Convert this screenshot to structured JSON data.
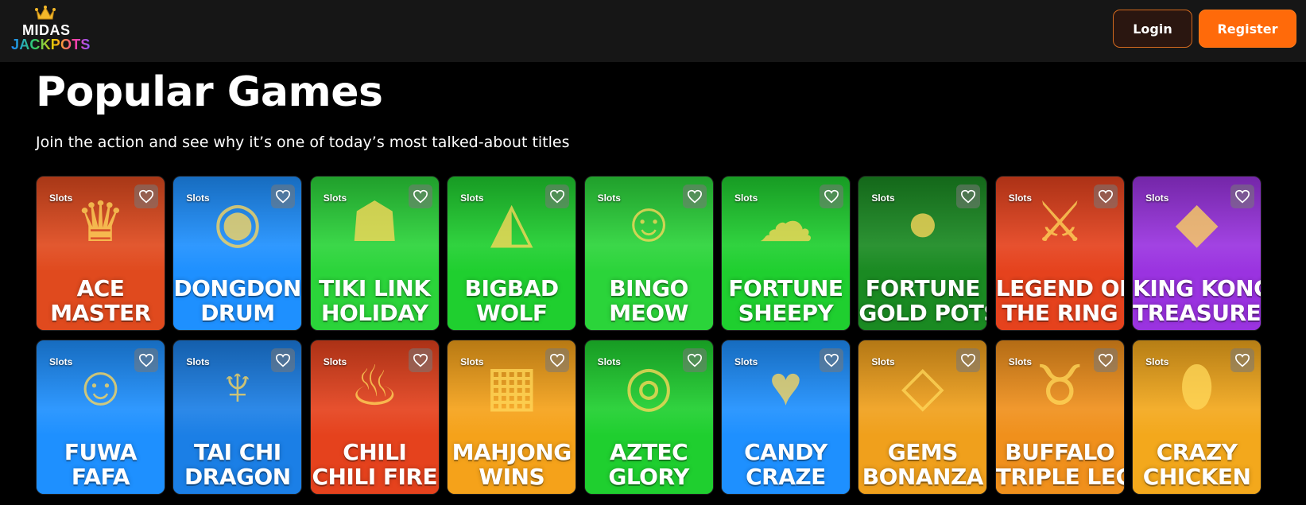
{
  "header": {
    "logo_line1": "MIDAS",
    "logo_line2": "JACKPOTS",
    "login_label": "Login",
    "register_label": "Register"
  },
  "section": {
    "title": "Popular Games",
    "subtitle": "Join the action and see why it’s one of today’s most talked-about titles"
  },
  "games": [
    {
      "tag": "Slots",
      "name": "ACE\nMASTER",
      "bg": "#e04a1e",
      "icon": "woman-icon"
    },
    {
      "tag": "Slots",
      "name": "DONGDONG\nDRUM",
      "bg": "#1e90ff",
      "icon": "drum-icon"
    },
    {
      "tag": "Slots",
      "name": "TIKI LINK\nHOLIDAY",
      "bg": "#2bd43a",
      "icon": "tiki-icon"
    },
    {
      "tag": "Slots",
      "name": "BIGBAD\nWOLF",
      "bg": "#1fcf2f",
      "icon": "wolf-icon"
    },
    {
      "tag": "Slots",
      "name": "BINGO\nMEOW",
      "bg": "#2bd43a",
      "icon": "cat-icon"
    },
    {
      "tag": "Slots",
      "name": "FORTUNE\nSHEEPY",
      "bg": "#1fcf2f",
      "icon": "sheep-icon"
    },
    {
      "tag": "Slots",
      "name": "FORTUNE\nGOLD POTS",
      "bg": "#1a8a22",
      "icon": "coins-icon"
    },
    {
      "tag": "Slots",
      "name": "LEGEND OF\nTHE RING",
      "bg": "#e5421d",
      "icon": "sword-icon"
    },
    {
      "tag": "Slots",
      "name": "KING KONG\nTREASURE",
      "bg": "#9a33e0",
      "icon": "gorilla-icon"
    },
    {
      "tag": "Slots",
      "name": "FUWA\nFAFA",
      "bg": "#1e90ff",
      "icon": "girl-icon"
    },
    {
      "tag": "Slots",
      "name": "TAI CHI\nDRAGON",
      "bg": "#1b7fe6",
      "icon": "dragon-icon"
    },
    {
      "tag": "Slots",
      "name": "CHILI\nCHILI FIRE",
      "bg": "#e5421d",
      "icon": "chili-icon"
    },
    {
      "tag": "Slots",
      "name": "MAHJONG\nWINS",
      "bg": "#f5a21a",
      "icon": "mahjong-icon"
    },
    {
      "tag": "Slots",
      "name": "AZTEC\nGLORY",
      "bg": "#1fcf2f",
      "icon": "aztec-icon"
    },
    {
      "tag": "Slots",
      "name": "CANDY\nCRAZE",
      "bg": "#1e90ff",
      "icon": "bear-icon"
    },
    {
      "tag": "Slots",
      "name": "GEMS\nBONANZA",
      "bg": "#f0a01c",
      "icon": "gems-icon"
    },
    {
      "tag": "Slots",
      "name": "BUFFALO\nTRIPLE LEGEND",
      "bg": "#f0901c",
      "icon": "buffalo-icon"
    },
    {
      "tag": "Slots",
      "name": "CRAZY\nCHICKEN",
      "bg": "#f3a81c",
      "icon": "egg-icon"
    }
  ],
  "colors": {
    "accent": "#ff6a0a",
    "header_bg": "#161616",
    "page_bg": "#000000"
  }
}
